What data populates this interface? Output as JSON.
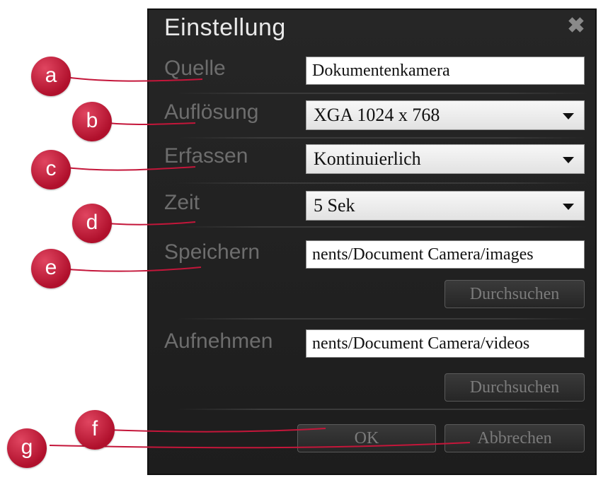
{
  "dialog": {
    "title": "Einstellung",
    "close_icon": "close-icon",
    "fields": {
      "quelle": {
        "label": "Quelle",
        "value": "Dokumentenkamera"
      },
      "aufloesung": {
        "label": "Auflösung",
        "value": "XGA 1024 x 768"
      },
      "erfassen": {
        "label": "Erfassen",
        "value": "Kontinuierlich"
      },
      "zeit": {
        "label": "Zeit",
        "value": "5 Sek"
      },
      "speichern": {
        "label": "Speichern",
        "value": "nents/Document Camera/images",
        "browse_label": "Durchsuchen"
      },
      "aufnehmen": {
        "label": "Aufnehmen",
        "value": "nents/Document Camera/videos",
        "browse_label": "Durchsuchen"
      }
    },
    "ok_label": "OK",
    "cancel_label": "Abbrechen"
  },
  "markers": [
    "a",
    "b",
    "c",
    "d",
    "e",
    "f",
    "g"
  ],
  "colors": {
    "marker": "#c4163a",
    "dialog_bg": "#222222"
  }
}
